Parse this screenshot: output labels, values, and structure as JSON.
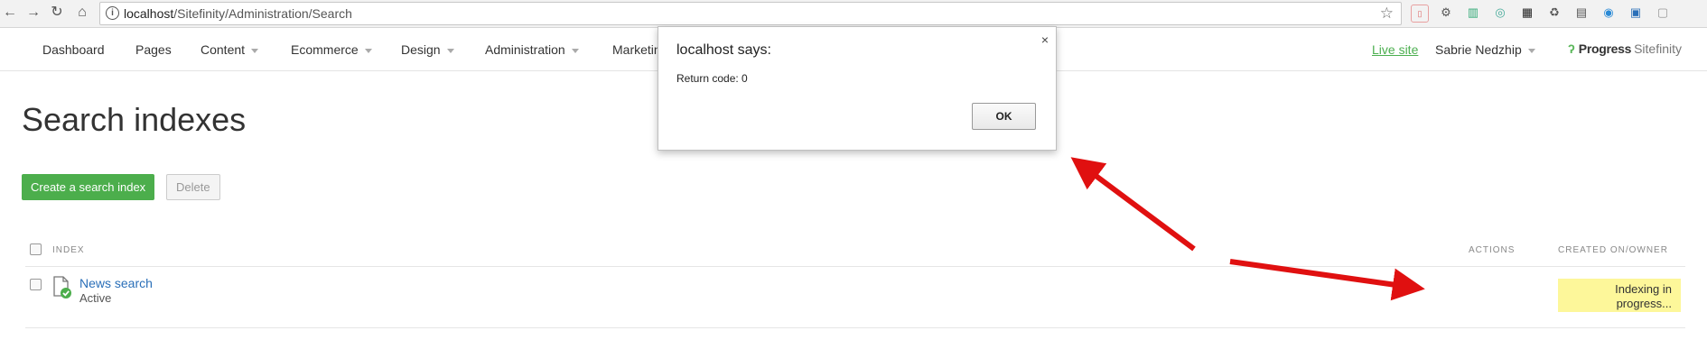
{
  "browser": {
    "url_host": "localhost",
    "url_path": "/Sitefinity/Administration/Search"
  },
  "nav": {
    "items": [
      "Dashboard",
      "Pages",
      "Content",
      "Ecommerce",
      "Design",
      "Administration",
      "Marketin"
    ],
    "live_site": "Live site",
    "user": "Sabrie Nedzhip",
    "logo_brand": "Progress",
    "logo_product": "Sitefinity"
  },
  "page": {
    "title": "Search indexes",
    "create_button": "Create a search index",
    "delete_button": "Delete"
  },
  "table": {
    "headers": {
      "index": "INDEX",
      "actions": "ACTIONS",
      "created": "CREATED ON/OWNER"
    },
    "rows": [
      {
        "name": "News search",
        "status": "Active",
        "created_line1": "Indexing in",
        "created_line2": "progress..."
      }
    ]
  },
  "dialog": {
    "title": "localhost says:",
    "message": "Return code: 0",
    "ok": "OK",
    "close": "×"
  },
  "colors": {
    "primary_green": "#4cae4c",
    "link_blue": "#2a6fb8",
    "highlight_yellow": "#fdf79a",
    "arrow_red": "#e01010"
  }
}
